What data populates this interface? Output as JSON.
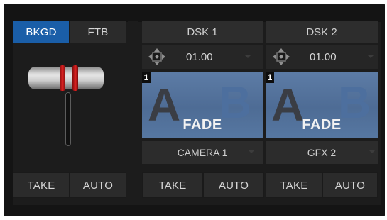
{
  "transition": {
    "tabs": [
      {
        "label": "BKGD",
        "active": true
      },
      {
        "label": "FTB",
        "active": false
      }
    ],
    "take_label": "TAKE",
    "auto_label": "AUTO"
  },
  "dsks": [
    {
      "title": "DSK 1",
      "duration": "01.00",
      "layer_number": "1",
      "effect": "FADE",
      "source": "CAMERA 1",
      "take_label": "TAKE",
      "auto_label": "AUTO"
    },
    {
      "title": "DSK 2",
      "duration": "01.00",
      "layer_number": "1",
      "effect": "FADE",
      "source": "GFX 2",
      "take_label": "TAKE",
      "auto_label": "AUTO"
    }
  ],
  "colors": {
    "active_tab": "#1a5ea8",
    "tbar_marker": "#e02222",
    "thumbnail": "#5d7ca6"
  }
}
